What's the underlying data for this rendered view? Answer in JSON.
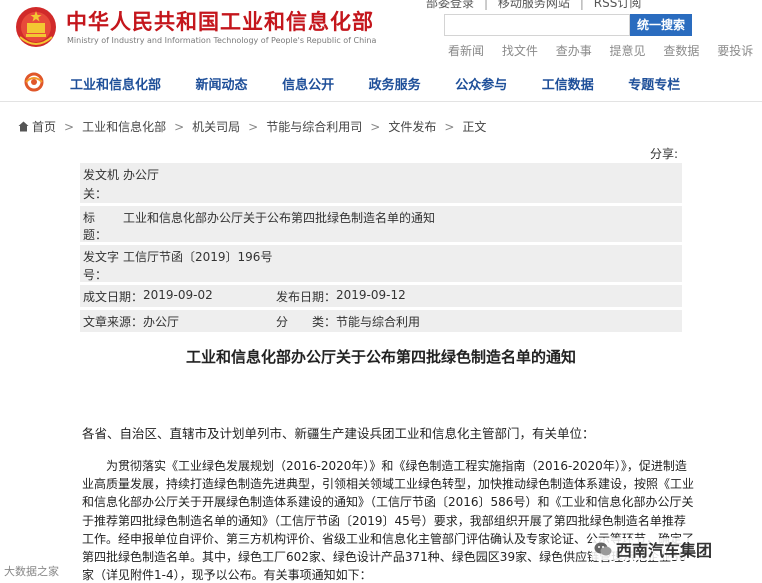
{
  "header": {
    "site_title": "中华人民共和国工业和信息化部",
    "site_subtitle": "Ministry of Industry and Information Technology of People's Republic of China",
    "top_links": [
      "部委登录",
      "移动服务网站",
      "RSS订阅"
    ],
    "search_placeholder": "",
    "search_button": "统一搜索",
    "quick_links": [
      "看新闻",
      "找文件",
      "查办事",
      "提意见",
      "查数据",
      "要投诉"
    ]
  },
  "nav": {
    "items": [
      "工业和信息化部",
      "新闻动态",
      "信息公开",
      "政务服务",
      "公众参与",
      "工信数据",
      "专题专栏"
    ]
  },
  "breadcrumb": [
    "首页",
    "工业和信息化部",
    "机关司局",
    "节能与综合利用司",
    "文件发布",
    "正文"
  ],
  "share_label": "分享:",
  "meta": {
    "issuer_label_a": "发文机",
    "issuer_label_b": "关：",
    "issuer_value": "办公厅",
    "title_label_a": "标",
    "title_label_b": "题：",
    "title_value": "工业和信息化部办公厅关于公布第四批绿色制造名单的通知",
    "docno_label_a": "发文字",
    "docno_label_b": "号：",
    "docno_value": "工信厅节函〔2019〕196号",
    "created_label": "成文日期：",
    "created_value": "2019-09-02",
    "published_label": "发布日期：",
    "published_value": "2019-09-12",
    "source_label": "文章来源：",
    "source_value": "办公厅",
    "category_label": "分　　类：",
    "category_value": "节能与综合利用"
  },
  "document": {
    "title": "工业和信息化部办公厅关于公布第四批绿色制造名单的通知",
    "salutation": "各省、自治区、直辖市及计划单列市、新疆生产建设兵团工业和信息化主管部门，有关单位：",
    "paragraph": "为贯彻落实《工业绿色发展规划（2016-2020年）》和《绿色制造工程实施指南（2016-2020年）》，促进制造业高质量发展，持续打造绿色制造先进典型，引领相关领域工业绿色转型，加快推动绿色制造体系建设，按照《工业和信息化部办公厅关于开展绿色制造体系建设的通知》（工信厅节函〔2016〕586号）和《工业和信息化部办公厅关于推荐第四批绿色制造名单的通知》（工信厅节函〔2019〕45号）要求，我部组织开展了第四批绿色制造名单推荐工作。经申报单位自评价、第三方机构评价、省级工业和信息化主管部门评估确认及专家论证、公示等环节，确定了第四批绿色制造名单。其中，绿色工厂602家、绿色设计产品371种、绿色园区39家、绿色供应链管理示范企业50家（详见附件1-4），现予以公布。有关事项通知如下："
  },
  "watermarks": {
    "left": "大数据之家",
    "right": "西南汽车集团"
  }
}
